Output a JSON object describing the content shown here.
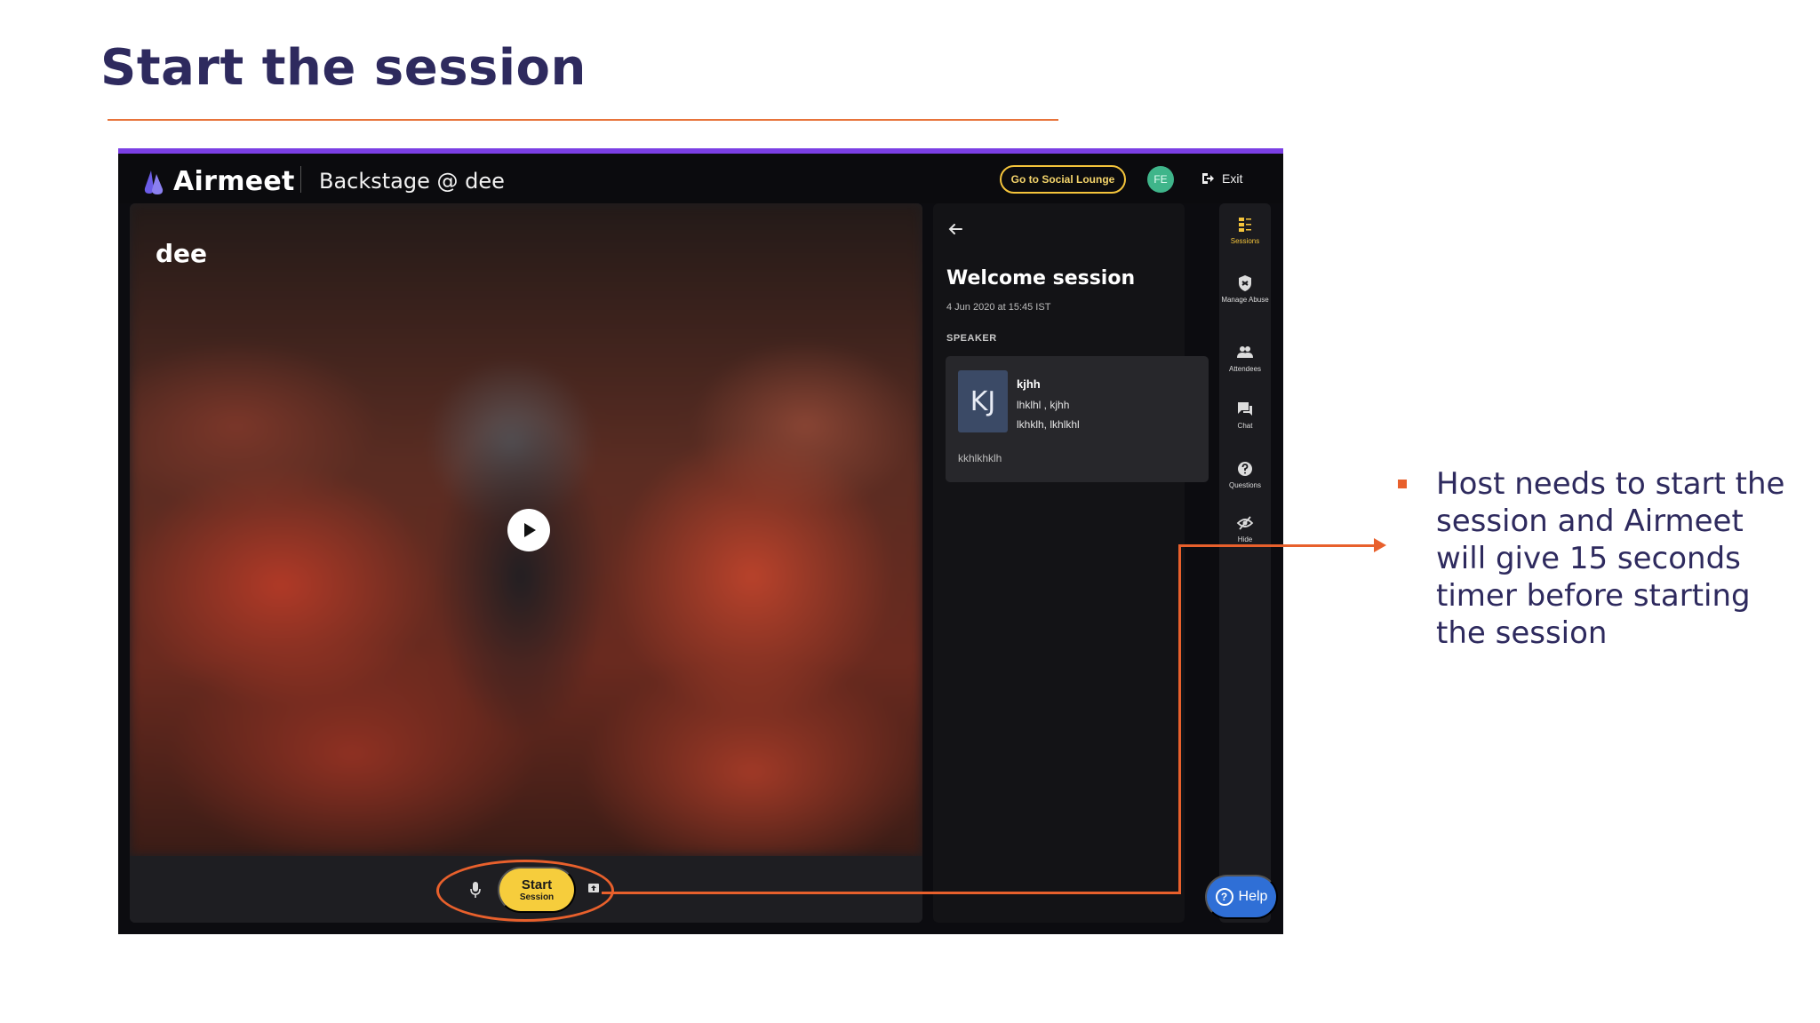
{
  "slide": {
    "title": "Start the session",
    "bullet": "Host needs to start the session and Airmeet will give 15 seconds timer before starting the session",
    "accent_color": "#e8602c",
    "title_color": "#2e2a5e"
  },
  "app": {
    "brand": "Airmeet",
    "backstage_title": "Backstage @ dee",
    "social_lounge_button": "Go to Social Lounge",
    "user_initials": "FE",
    "exit_label": "Exit"
  },
  "stage": {
    "presenter_name": "dee",
    "start_label_line1": "Start",
    "start_label_line2": "Session",
    "start_button_color": "#f6cd3c"
  },
  "panel": {
    "session_title": "Welcome session",
    "session_date": "4 Jun 2020 at 15:45 IST",
    "speaker_heading": "SPEAKER",
    "speaker": {
      "initials": "KJ",
      "name": "kjhh",
      "line1": "lhklhl , kjhh",
      "line2": "lkhklh, lkhlkhl",
      "bio": "kkhlkhklh"
    }
  },
  "sidebar": {
    "items": [
      {
        "label": "Sessions",
        "icon": "sessions-icon",
        "active": true
      },
      {
        "label": "Manage Abuse",
        "icon": "shield-icon",
        "active": false
      },
      {
        "label": "Attendees",
        "icon": "people-icon",
        "active": false
      },
      {
        "label": "Chat",
        "icon": "chat-icon",
        "active": false
      },
      {
        "label": "Questions",
        "icon": "question-icon",
        "active": false
      },
      {
        "label": "Hide",
        "icon": "eye-off-icon",
        "active": false
      }
    ]
  },
  "help": {
    "label": "Help"
  }
}
